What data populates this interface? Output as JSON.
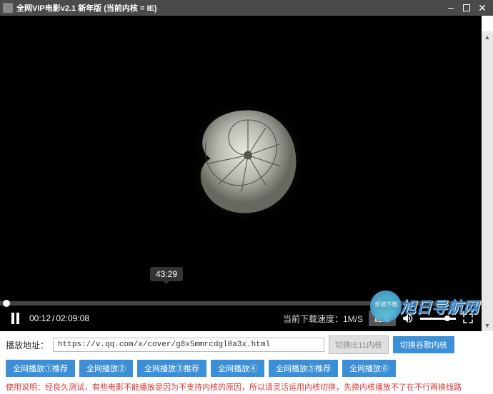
{
  "window": {
    "title": "全网VIP电影v2.1 新年版 (当前内核 = IE)"
  },
  "player": {
    "current_time": "00:12",
    "total_time": "02:09:08",
    "hover_time": "43:29",
    "download_speed_label": "当前下载速度：1M/S",
    "quality_label": "超清"
  },
  "url_bar": {
    "label": "播放地址：",
    "value": "https://v.qq.com/x/cover/g8x5mmrcdgl0a3x.html",
    "switch_ie_label": "切换IE11内核",
    "switch_chrome_label": "切换谷歌内核"
  },
  "recommend": {
    "btns": [
      "全网播放①推荐",
      "全网播放②",
      "全网播放③推荐",
      "全网播放④",
      "全网播放⑤推荐",
      "全网播放⑥"
    ]
  },
  "usage": "使用说明：经良久测试，有些电影不能播放是因为不支持内核的原因，所以请灵活运用内核切换，先换内核播放不了在不行再换线路",
  "watermark": {
    "site": "旭日导航网"
  }
}
